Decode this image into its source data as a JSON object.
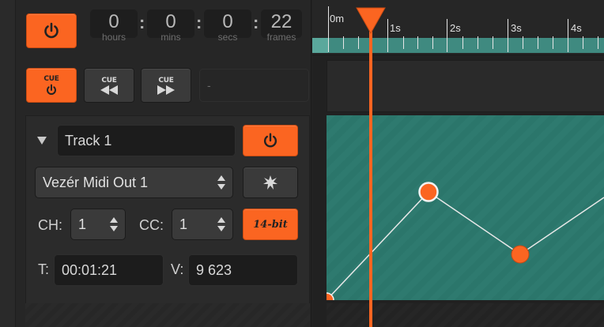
{
  "timecode": {
    "hours": {
      "value": "0",
      "unit": "hours"
    },
    "mins": {
      "value": "0",
      "unit": "mins"
    },
    "secs": {
      "value": "0",
      "unit": "secs"
    },
    "frames": {
      "value": "22",
      "unit": "frames"
    }
  },
  "cue": {
    "cue_label": "CUE",
    "prev_label": "CUE",
    "next_label": "CUE",
    "cue_name": "-"
  },
  "track": {
    "name": "Track 1",
    "output": "Vezér Midi Out 1",
    "ch_label": "CH:",
    "ch_value": "1",
    "cc_label": "CC:",
    "cc_value": "1",
    "bit_label": "14-bit",
    "t_label": "T:",
    "t_value": "00:01:21",
    "v_label": "V:",
    "v_value": "9 623"
  },
  "ruler": {
    "labels": [
      "0m",
      "1s",
      "2s",
      "3s",
      "4s"
    ]
  },
  "colors": {
    "accent": "#fb6521",
    "track_fill": "#2e7a6f",
    "ruler_band": "#3f8a80"
  },
  "icons": {
    "power": "power-icon",
    "rewind": "rewind-icon",
    "forward": "forward-icon",
    "learn": "burst-icon",
    "dropdown": "triangle-down-icon",
    "stepper": "up-down-arrows-icon"
  }
}
